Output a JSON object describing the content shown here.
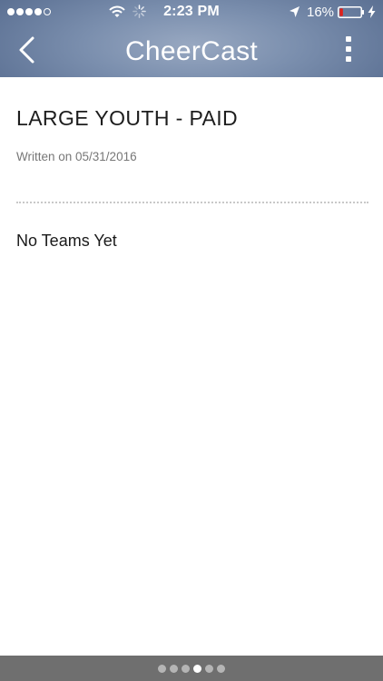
{
  "status_bar": {
    "signal": {
      "filled": 4,
      "total": 5
    },
    "time": "2:23 PM",
    "battery_percent": "16%",
    "battery_level": 0.16,
    "icons": [
      "wifi-icon",
      "activity-spinner-icon",
      "location-arrow-icon",
      "battery-icon",
      "charging-bolt-icon"
    ]
  },
  "nav": {
    "title": "CheerCast",
    "back_icon": "chevron-left-icon",
    "menu_icon": "vertical-ellipsis-icon"
  },
  "article": {
    "title": "LARGE YOUTH - PAID",
    "written_on": "Written on 05/31/2016",
    "empty_message": "No Teams Yet"
  },
  "pager": {
    "count": 6,
    "active_index": 3
  },
  "colors": {
    "header_light": "#98a8c1",
    "header_dark": "#5a6f92",
    "footer": "#6f6f6f",
    "battery_low": "#e0211b"
  }
}
